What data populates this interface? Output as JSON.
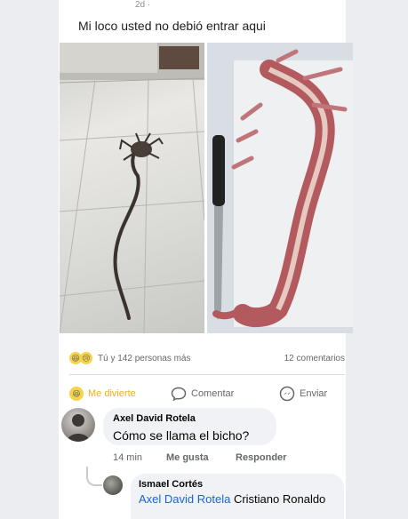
{
  "header": {
    "top_stub": "2d ·"
  },
  "post": {
    "text": "Mi loco usted no debió entrar aqui"
  },
  "reactions": {
    "summary": "Tú y 142 personas más",
    "comments_count": "12 comentarios"
  },
  "actions": {
    "reaction_label": "Me divierte",
    "comment_label": "Comentar",
    "share_label": "Enviar"
  },
  "comments": [
    {
      "author": "Axel David Rotela",
      "text": "Cómo se llama el bicho?",
      "time": "14 min",
      "like_label": "Me gusta",
      "reply_label": "Responder"
    }
  ],
  "replies": [
    {
      "author": "Ismael Cortés",
      "mention": "Axel David Rotela",
      "text": "Cristiano Ronaldo"
    }
  ],
  "colors": {
    "mention": "#1565d8",
    "reaction_active": "#eab026",
    "bubble": "#f0f2f5"
  }
}
